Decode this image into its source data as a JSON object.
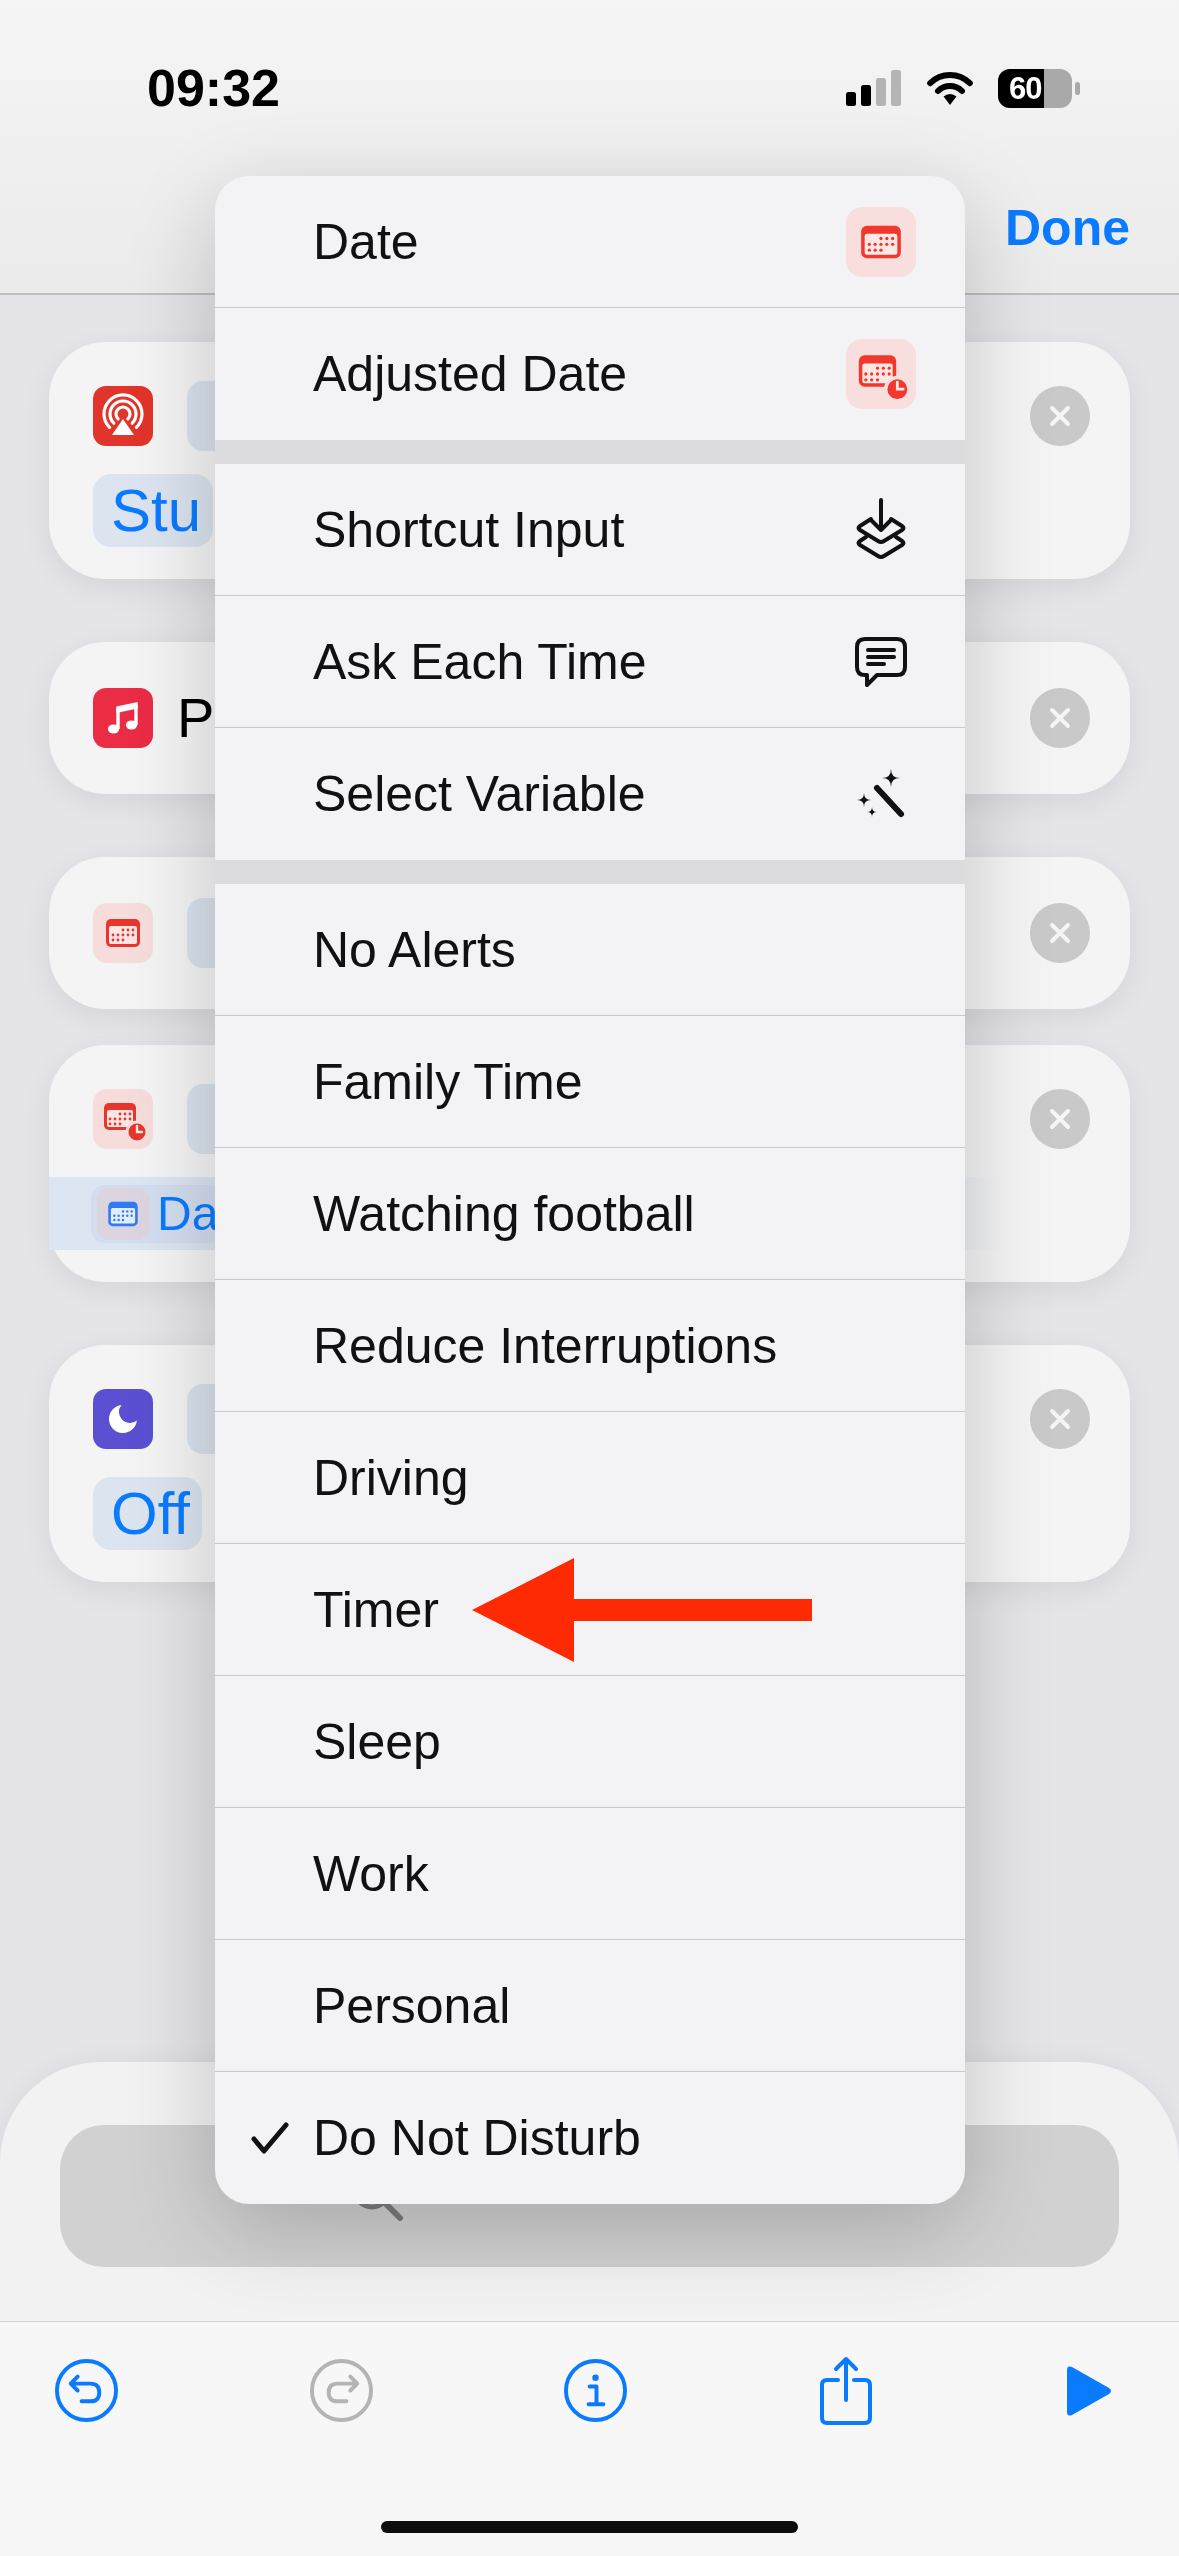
{
  "status_bar": {
    "time": "09:32",
    "battery": "60"
  },
  "nav_bar": {
    "done": "Done"
  },
  "actions": [
    {
      "kind": "token",
      "parameter": {
        "kind": "plain",
        "text": "Stu",
        "highlighted": false
      }
    },
    {
      "kind": "text",
      "title": "P"
    },
    {
      "kind": "token"
    },
    {
      "kind": "token",
      "parameter": {
        "kind": "variable",
        "text": "Da",
        "highlighted": true
      }
    },
    {
      "kind": "token",
      "parameter": {
        "kind": "plain",
        "text": "Off",
        "highlighted": false
      }
    }
  ],
  "menu": {
    "sections": [
      {
        "items": [
          {
            "label": "Date"
          },
          {
            "label": "Adjusted Date"
          }
        ]
      },
      {
        "items": [
          {
            "label": "Shortcut Input"
          },
          {
            "label": "Ask Each Time"
          },
          {
            "label": "Select Variable"
          }
        ]
      },
      {
        "items": [
          {
            "label": "No Alerts",
            "selected": false
          },
          {
            "label": "Family Time",
            "selected": false
          },
          {
            "label": "Watching football",
            "selected": false
          },
          {
            "label": "Reduce Interruptions",
            "selected": false
          },
          {
            "label": "Driving",
            "selected": false
          },
          {
            "label": "Timer",
            "selected": false,
            "arrow": true
          },
          {
            "label": "Sleep",
            "selected": false
          },
          {
            "label": "Work",
            "selected": false
          },
          {
            "label": "Personal",
            "selected": false
          },
          {
            "label": "Do Not Disturb",
            "selected": true
          }
        ]
      }
    ]
  },
  "toolbar": {
    "buttons": [
      {
        "disabled": false
      },
      {
        "disabled": true
      },
      {
        "disabled": false
      },
      {
        "disabled": false
      },
      {
        "disabled": false
      }
    ]
  }
}
